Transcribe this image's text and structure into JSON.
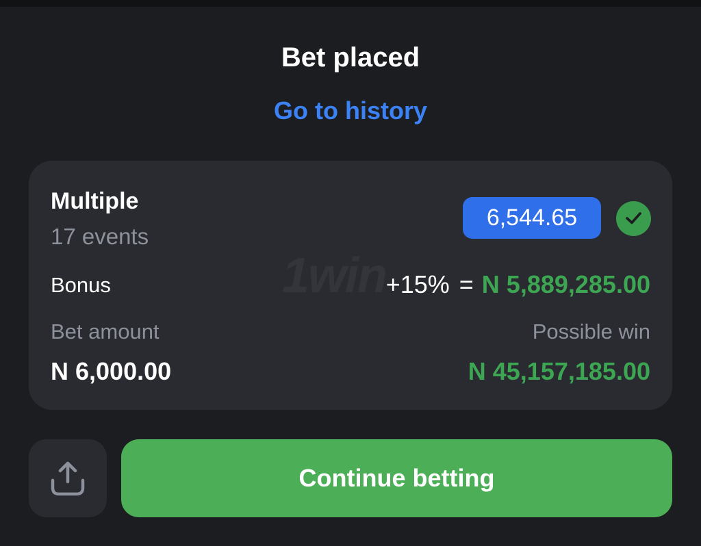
{
  "header": {
    "title": "Bet placed",
    "history_link": "Go to history"
  },
  "bet": {
    "type": "Multiple",
    "events": "17 events",
    "odds": "6,544.65",
    "status_icon": "check-icon",
    "bonus_label": "Bonus",
    "bonus_percent": "+15%",
    "bonus_equals": "=",
    "bonus_amount": "N 5,889,285.00",
    "bet_amount_label": "Bet amount",
    "bet_amount": "N 6,000.00",
    "possible_win_label": "Possible win",
    "possible_win": "N 45,157,185.00",
    "watermark": "1win"
  },
  "actions": {
    "share_icon": "share-icon",
    "continue_label": "Continue betting"
  },
  "colors": {
    "background": "#1c1d20",
    "card": "#2a2b30",
    "accent_blue": "#2f6fe9",
    "link_blue": "#3b82f6",
    "success_green": "#4caf58",
    "money_green": "#3da653",
    "muted_text": "#8d919b"
  }
}
